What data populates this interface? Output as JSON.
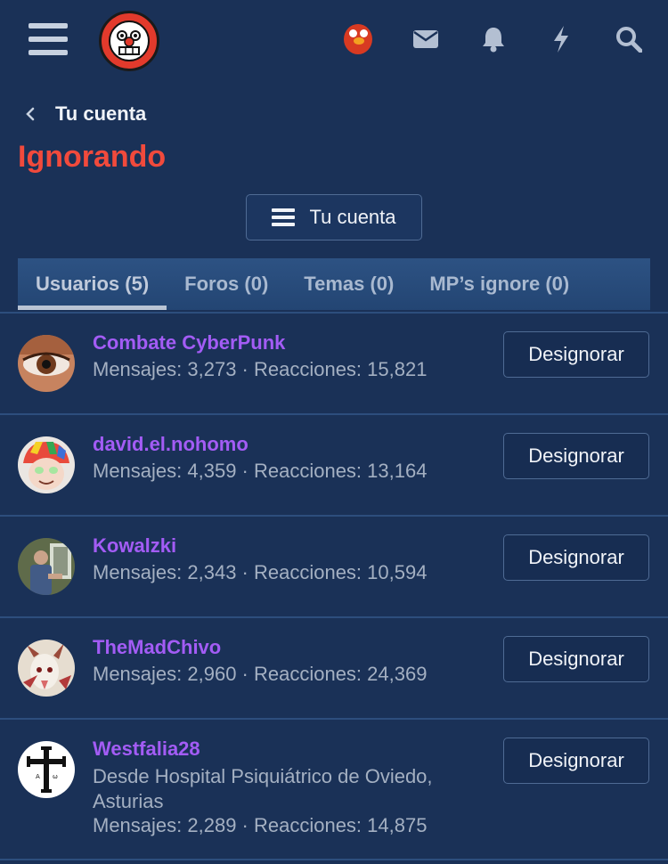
{
  "header": {
    "icons": [
      "menu-icon",
      "site-logo",
      "user-avatar",
      "mail-icon",
      "bell-icon",
      "bolt-icon",
      "search-icon"
    ]
  },
  "breadcrumb": {
    "label": "Tu cuenta"
  },
  "page": {
    "title": "Ignorando",
    "account_button": "Tu cuenta"
  },
  "tabs": [
    {
      "label": "Usuarios (5)",
      "active": true
    },
    {
      "label": "Foros (0)"
    },
    {
      "label": "Temas (0)"
    },
    {
      "label": "MP’s ignore (0)"
    }
  ],
  "users": [
    {
      "name": "Combate CyberPunk",
      "stats": "Mensajes: 3,273 · Reacciones: 15,821",
      "button": "Designorar"
    },
    {
      "name": "david.el.nohomo",
      "stats": "Mensajes: 4,359 · Reacciones: 13,164",
      "button": "Designorar"
    },
    {
      "name": "Kowalzki",
      "stats": "Mensajes: 2,343 · Reacciones: 10,594",
      "button": "Designorar"
    },
    {
      "name": "TheMadChivo",
      "stats": "Mensajes: 2,960 · Reacciones: 24,369",
      "button": "Designorar"
    },
    {
      "name": "Westfalia28",
      "location": "Desde Hospital Psiquiátrico de Oviedo, Asturias",
      "stats": "Mensajes: 2,289 · Reacciones: 14,875",
      "button": "Designorar"
    }
  ],
  "colors": {
    "background": "#1a3157",
    "title": "#f14a3c",
    "username": "#a35cf5",
    "muted": "#a4b0c2"
  }
}
